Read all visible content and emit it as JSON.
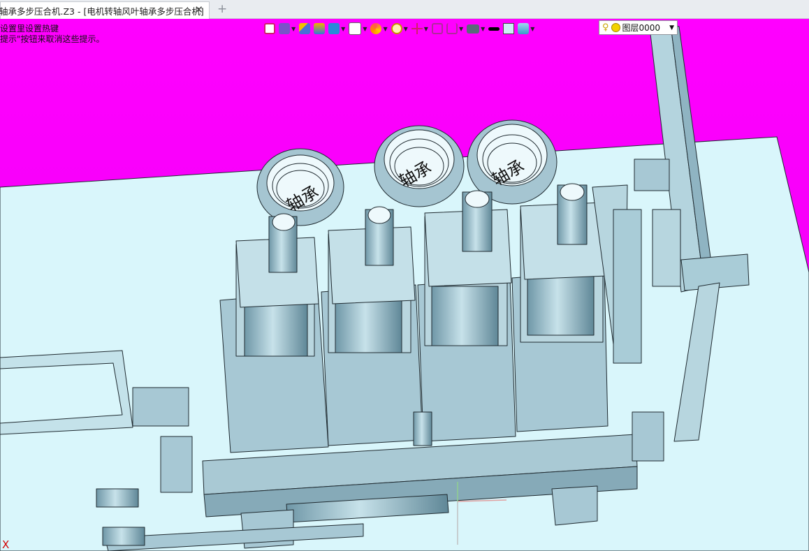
{
  "tab": {
    "title": "轴承多步压合机.Z3 - [电机转轴风叶轴承多步压合机]",
    "close_label": "✕",
    "new_tab_label": "+"
  },
  "hint": {
    "line1": "设置里设置热键",
    "line2": "提示\"按钮来取消这些提示。"
  },
  "toolbar": {
    "layer_value": "图层0000",
    "icons": [
      "exit-view-icon",
      "pick-filter-icon",
      "highlight-icon",
      "block-display-icon",
      "shaded-cube-icon",
      "view-cube-icon",
      "color-wheel-icon",
      "zoom-icon",
      "origin-icon",
      "frame-icon",
      "section-icon",
      "display-monitor-icon",
      "line-color-icon",
      "fill-color-icon",
      "layer-stack-icon"
    ]
  },
  "part_labels": [
    "轴承",
    "轴承",
    "轴承"
  ],
  "triad_label": "X",
  "colors": {
    "background_magenta": "#ff00ff",
    "floor": "#d9f6fb",
    "metal": "#a7c8d4",
    "edge": "#1f2a30"
  }
}
